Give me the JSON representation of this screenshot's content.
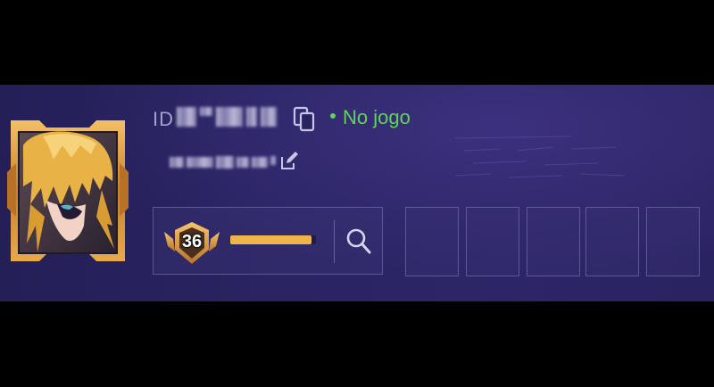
{
  "profile": {
    "id_label": "ID",
    "status_text": "No jogo",
    "level": "36",
    "xp_progress": 0.95,
    "colors": {
      "status": "#5fd35a",
      "xp_bar": "#f0b54a",
      "frame_gold": "#d9913a"
    }
  },
  "icons": {
    "copy": "copy-icon",
    "edit": "edit-icon",
    "search": "search-icon"
  },
  "slots": [
    {
      "content": ""
    },
    {
      "content": ""
    },
    {
      "content": ""
    },
    {
      "content": ""
    },
    {
      "content": ""
    }
  ]
}
